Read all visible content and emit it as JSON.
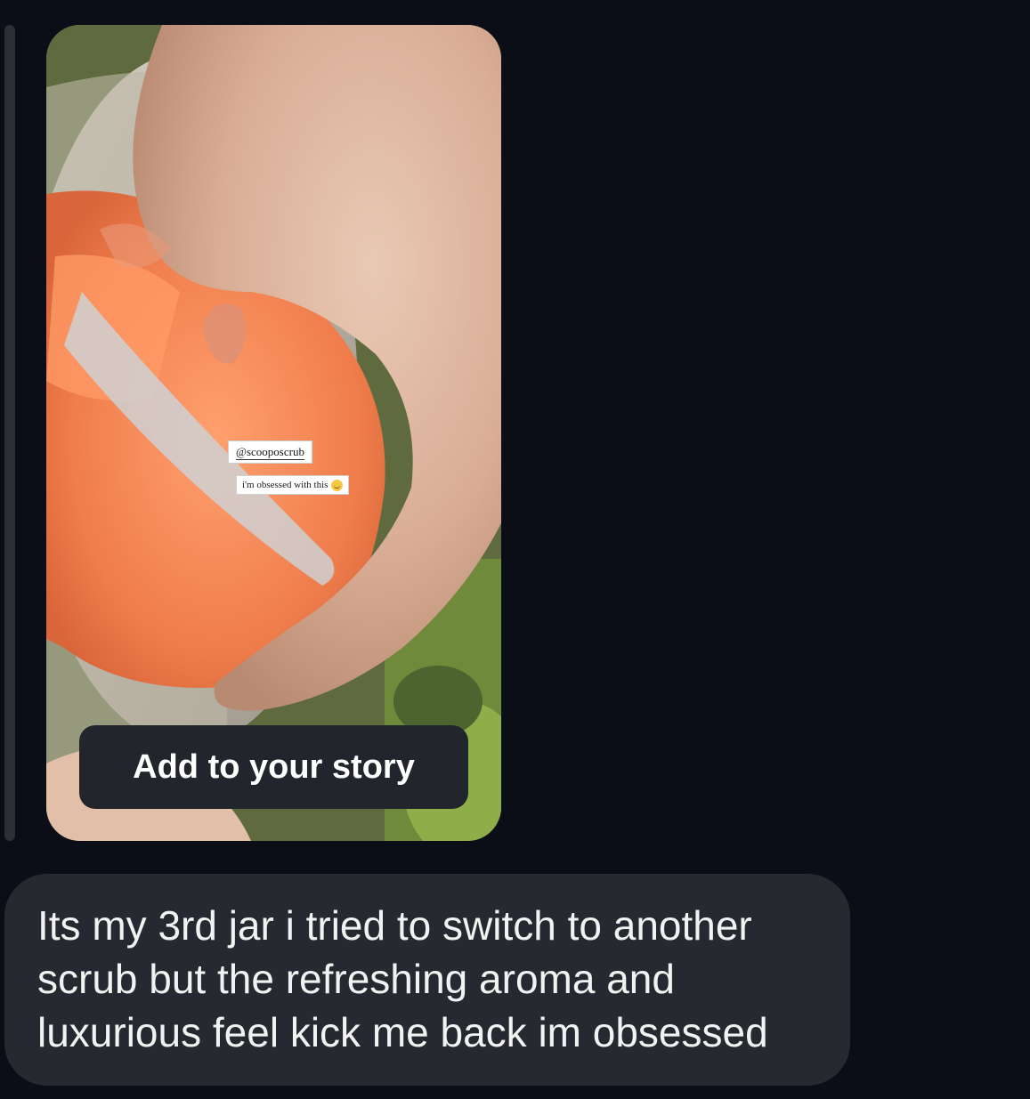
{
  "story": {
    "mention": "@scooposcrub",
    "caption": "i'm obsessed with this",
    "caption_emoji": "smiling-face-icon",
    "add_button_label": "Add to your story"
  },
  "message": {
    "text": "Its my 3rd jar i tried to switch to another\nscrub but the refreshing aroma and\nluxurious feel kick me back im obsessed"
  },
  "colors": {
    "background": "#0b0e16",
    "bubble": "#26292f",
    "button": "#22252c",
    "scrub_orange": "#f08a5a"
  }
}
